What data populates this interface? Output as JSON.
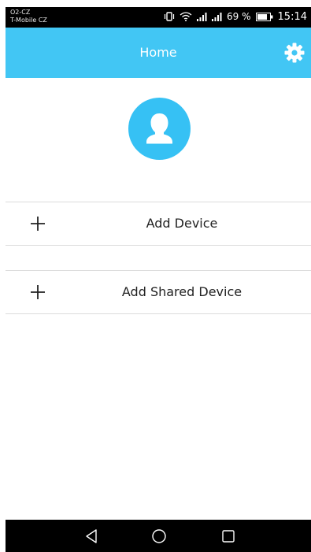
{
  "statusbar": {
    "carrier1": "O2-CZ",
    "carrier2": "T-Mobile CZ",
    "battery_percent": "69 %",
    "time": "15:14",
    "icons": [
      "vibrate-icon",
      "wifi-icon",
      "signal-icon",
      "signal-icon",
      "battery-icon"
    ]
  },
  "header": {
    "title": "Home",
    "settings_icon": "gear-icon",
    "color": "#42c6f4"
  },
  "avatar": {
    "icon": "user-icon",
    "color": "#36c1f4"
  },
  "list": {
    "items": [
      {
        "label": "Add Device",
        "icon": "plus-icon"
      },
      {
        "label": "Add Shared Device",
        "icon": "plus-icon"
      }
    ]
  },
  "navbar": {
    "icons": [
      "back-icon",
      "home-icon",
      "recent-apps-icon"
    ]
  }
}
